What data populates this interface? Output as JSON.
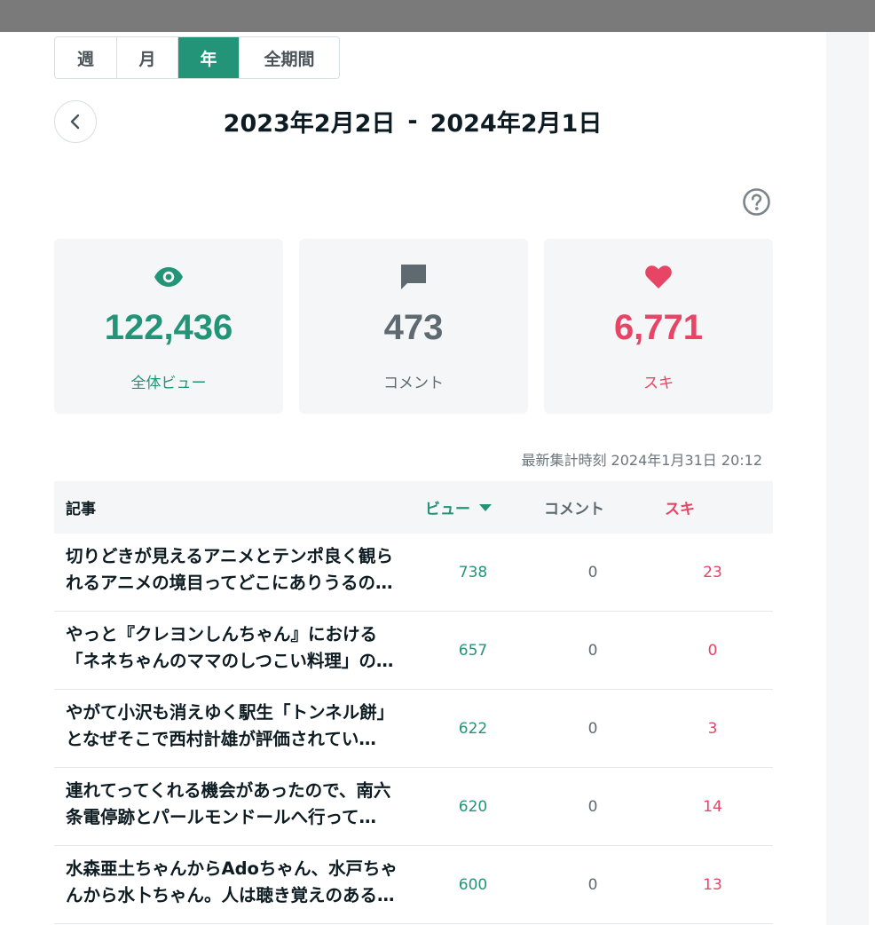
{
  "tabs": [
    {
      "label": "週",
      "active": false
    },
    {
      "label": "月",
      "active": false
    },
    {
      "label": "年",
      "active": true
    },
    {
      "label": "全期間",
      "active": false
    }
  ],
  "date_range": {
    "start": "2023年2月2日",
    "separator": "-",
    "end": "2024年2月1日"
  },
  "summary": {
    "views": {
      "value": "122,436",
      "label": "全体ビュー",
      "icon": "eye-icon"
    },
    "comments": {
      "value": "473",
      "label": "コメント",
      "icon": "comment-icon"
    },
    "likes": {
      "value": "6,771",
      "label": "スキ",
      "icon": "heart-icon"
    }
  },
  "updated_at": "最新集計時刻 2024年1月31日 20:12",
  "table": {
    "headers": {
      "article": "記事",
      "views": "ビュー",
      "comments": "コメント",
      "likes": "スキ"
    },
    "rows": [
      {
        "title": "切りどきが見えるアニメとテンポ良く観られるアニメの境目ってどこにありうるの…",
        "views": "738",
        "comments": "0",
        "likes": "23"
      },
      {
        "title": "やっと『クレヨンしんちゃん』における「ネネちゃんのママのしつこい料理」の意味…",
        "views": "657",
        "comments": "0",
        "likes": "0"
      },
      {
        "title": "やがて小沢も消えゆく駅生「トンネル餅」となぜそこで西村計雄が評価されてい…",
        "views": "622",
        "comments": "0",
        "likes": "3"
      },
      {
        "title": "連れてってくれる機会があったので、南六条電停跡とパールモンドールへ行って…",
        "views": "620",
        "comments": "0",
        "likes": "14"
      },
      {
        "title": "水森亜土ちゃんからAdoちゃん、水戸ちゃんから水卜ちゃん。人は聴き覚えのある…",
        "views": "600",
        "comments": "0",
        "likes": "13"
      }
    ]
  },
  "colors": {
    "accent": "#249479",
    "like": "#e64565",
    "muted": "#5f6a70"
  }
}
